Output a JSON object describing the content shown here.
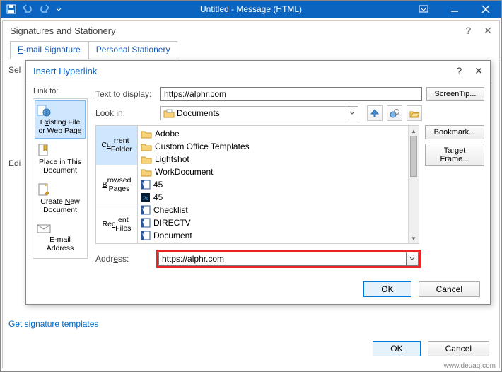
{
  "titlebar": {
    "title": "Untitled  -  Message (HTML)"
  },
  "sig_dialog": {
    "header": "Signatures and Stationery",
    "tabs": {
      "email": "E-mail Signature",
      "personal": "Personal Stationery"
    },
    "sel_label": "Sel",
    "edit_label": "Edi",
    "link_text": "Get signature templates",
    "ok": "OK",
    "cancel": "Cancel"
  },
  "hyper": {
    "title": "Insert Hyperlink",
    "linkto_label": "Link to:",
    "text_label": "Text to display:",
    "text_value": "https://alphr.com",
    "screentip": "ScreenTip...",
    "lookin_label": "Look in:",
    "lookin_value": "Documents",
    "bookmark": "Bookmark...",
    "targetframe": "Target Frame...",
    "addr_label": "Address:",
    "addr_value": "https://alphr.com",
    "ok": "OK",
    "cancel": "Cancel",
    "linkto": {
      "existing": "Existing File or Web Page",
      "place": "Place in This Document",
      "create": "Create New Document",
      "email": "E-mail Address"
    },
    "btabs": {
      "current": "Current Folder",
      "browsed": "Browsed Pages",
      "recent": "Recent Files"
    },
    "files": [
      {
        "t": "folder",
        "n": "Adobe"
      },
      {
        "t": "folder",
        "n": "Custom Office Templates"
      },
      {
        "t": "folder",
        "n": "Lightshot"
      },
      {
        "t": "folder",
        "n": "WorkDocument"
      },
      {
        "t": "word",
        "n": "45"
      },
      {
        "t": "ps",
        "n": "45"
      },
      {
        "t": "word",
        "n": "Checklist"
      },
      {
        "t": "word",
        "n": "DIRECTV"
      },
      {
        "t": "word",
        "n": "Document"
      }
    ]
  },
  "watermark": "www.deuaq.com"
}
